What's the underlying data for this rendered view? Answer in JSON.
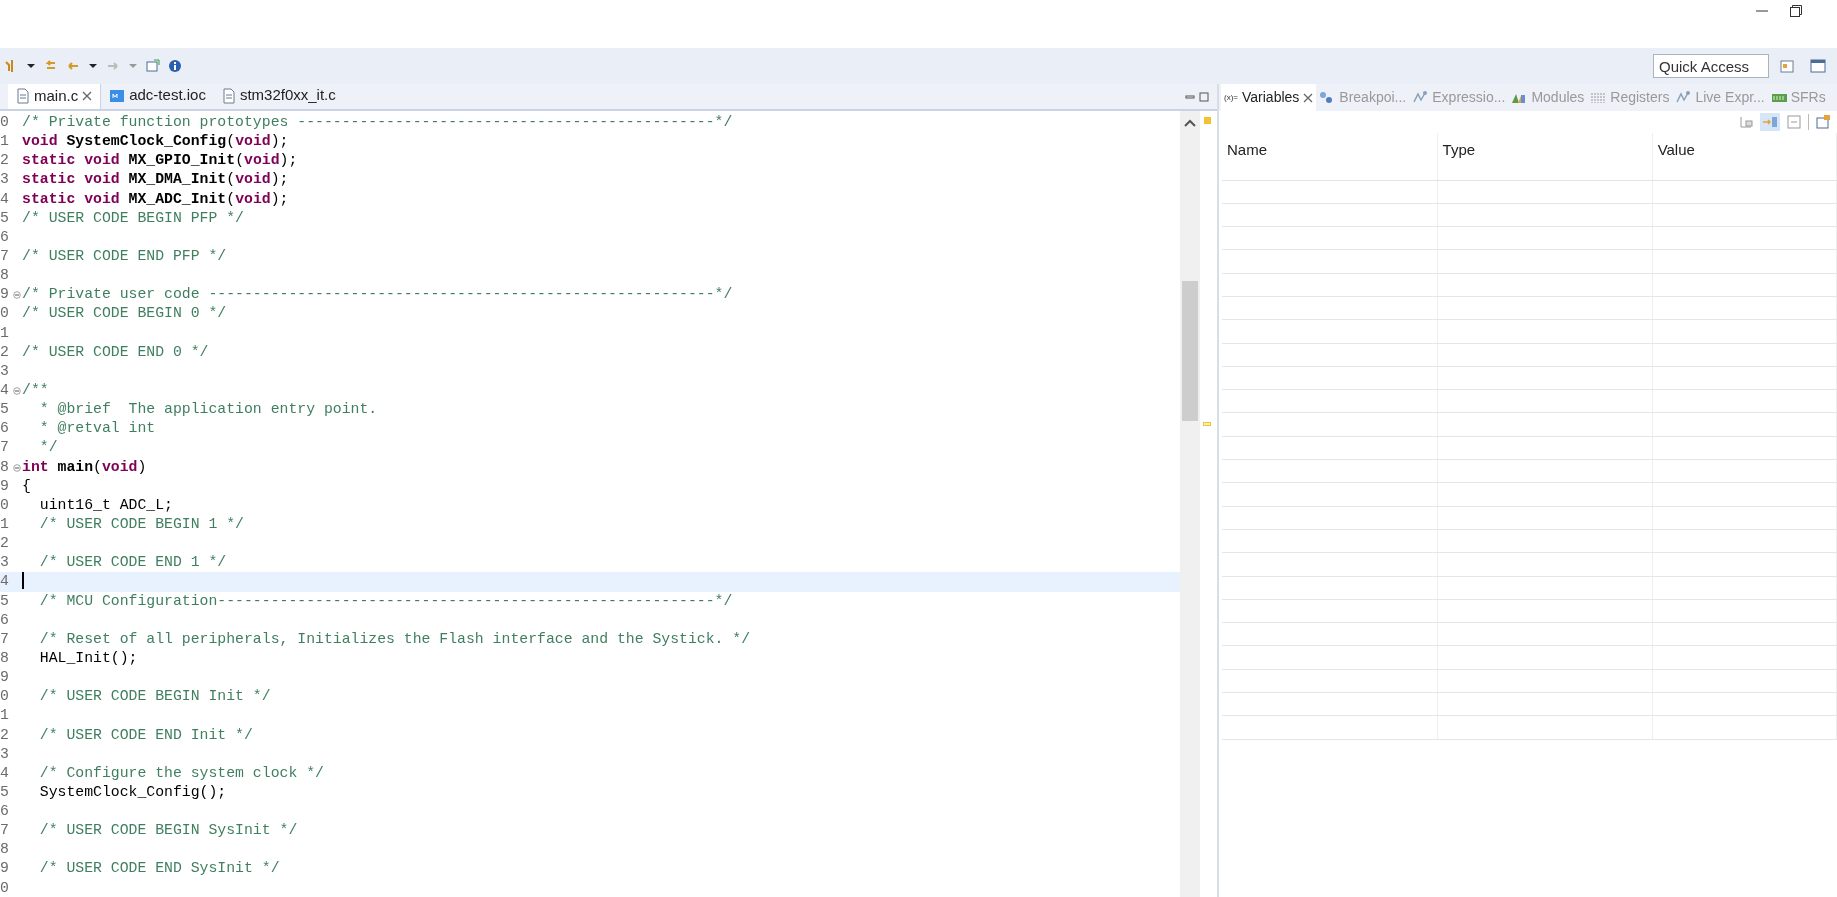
{
  "window_controls": {
    "minimize": true,
    "restore": true
  },
  "toolbar": {
    "quick_access": {
      "placeholder": "Quick Access"
    }
  },
  "editor": {
    "tabs": [
      {
        "label": "main.c",
        "kind": "c-file",
        "selected": true
      },
      {
        "label": "adc-test.ioc",
        "kind": "ioc",
        "selected": false
      },
      {
        "label": "stm32f0xx_it.c",
        "kind": "c-file",
        "selected": false
      }
    ],
    "lines": [
      {
        "number": "0",
        "segments": [
          {
            "kind": "comment",
            "text": "/* Private function prototypes -----------------------------------------------*/"
          }
        ]
      },
      {
        "number": "1",
        "segments": [
          {
            "kind": "keyword",
            "text": "void"
          },
          {
            "kind": "bold",
            "text": " SystemClock_Config"
          },
          {
            "kind": "plain",
            "text": "("
          },
          {
            "kind": "keyword",
            "text": "void"
          },
          {
            "kind": "plain",
            "text": ");"
          }
        ]
      },
      {
        "number": "2",
        "segments": [
          {
            "kind": "keyword",
            "text": "static void"
          },
          {
            "kind": "bold",
            "text": " MX_GPIO_Init"
          },
          {
            "kind": "plain",
            "text": "("
          },
          {
            "kind": "keyword",
            "text": "void"
          },
          {
            "kind": "plain",
            "text": ");"
          }
        ]
      },
      {
        "number": "3",
        "segments": [
          {
            "kind": "keyword",
            "text": "static void"
          },
          {
            "kind": "bold",
            "text": " MX_DMA_Init"
          },
          {
            "kind": "plain",
            "text": "("
          },
          {
            "kind": "keyword",
            "text": "void"
          },
          {
            "kind": "plain",
            "text": ");"
          }
        ]
      },
      {
        "number": "4",
        "segments": [
          {
            "kind": "keyword",
            "text": "static void"
          },
          {
            "kind": "bold",
            "text": " MX_ADC_Init"
          },
          {
            "kind": "plain",
            "text": "("
          },
          {
            "kind": "keyword",
            "text": "void"
          },
          {
            "kind": "plain",
            "text": ");"
          }
        ]
      },
      {
        "number": "5",
        "segments": [
          {
            "kind": "comment",
            "text": "/* USER CODE BEGIN PFP */"
          }
        ]
      },
      {
        "number": "6"
      },
      {
        "number": "7",
        "segments": [
          {
            "kind": "comment",
            "text": "/* USER CODE END PFP */"
          }
        ]
      },
      {
        "number": "8"
      },
      {
        "number": "9",
        "fold": true,
        "segments": [
          {
            "kind": "comment",
            "text": "/* Private user code ---------------------------------------------------------*/"
          }
        ]
      },
      {
        "number": "0",
        "segments": [
          {
            "kind": "comment",
            "text": "/* USER CODE BEGIN 0 */"
          }
        ]
      },
      {
        "number": "1"
      },
      {
        "number": "2",
        "segments": [
          {
            "kind": "comment",
            "text": "/* USER CODE END 0 */"
          }
        ]
      },
      {
        "number": "3"
      },
      {
        "number": "4",
        "fold": true,
        "segments": [
          {
            "kind": "comment",
            "text": "/**"
          }
        ]
      },
      {
        "number": "5",
        "segments": [
          {
            "kind": "comment",
            "text": "  * @brief  The application entry point."
          }
        ]
      },
      {
        "number": "6",
        "segments": [
          {
            "kind": "comment",
            "text": "  * @retval int"
          }
        ]
      },
      {
        "number": "7",
        "segments": [
          {
            "kind": "comment",
            "text": "  */"
          }
        ]
      },
      {
        "number": "8",
        "fold": true,
        "segments": [
          {
            "kind": "keyword",
            "text": "int"
          },
          {
            "kind": "bold",
            "text": " main"
          },
          {
            "kind": "plain",
            "text": "("
          },
          {
            "kind": "keyword",
            "text": "void"
          },
          {
            "kind": "plain",
            "text": ")"
          }
        ]
      },
      {
        "number": "9",
        "segments": [
          {
            "kind": "plain",
            "text": "{"
          }
        ]
      },
      {
        "number": "0",
        "segments": [
          {
            "kind": "plain",
            "text": "  uint16_t ADC_L;"
          }
        ]
      },
      {
        "number": "1",
        "segments": [
          {
            "kind": "comment",
            "text": "  /* USER CODE BEGIN 1 */"
          }
        ]
      },
      {
        "number": "2"
      },
      {
        "number": "3",
        "segments": [
          {
            "kind": "comment",
            "text": "  /* USER CODE END 1 */"
          }
        ]
      },
      {
        "number": "4",
        "current": true
      },
      {
        "number": "5",
        "segments": [
          {
            "kind": "comment",
            "text": "  /* MCU Configuration--------------------------------------------------------*/"
          }
        ]
      },
      {
        "number": "6"
      },
      {
        "number": "7",
        "segments": [
          {
            "kind": "comment",
            "text": "  /* Reset of all peripherals, Initializes the Flash interface and the Systick. */"
          }
        ]
      },
      {
        "number": "8",
        "segments": [
          {
            "kind": "plain",
            "text": "  HAL_Init();"
          }
        ]
      },
      {
        "number": "9"
      },
      {
        "number": "0",
        "segments": [
          {
            "kind": "comment",
            "text": "  /* USER CODE BEGIN Init */"
          }
        ]
      },
      {
        "number": "1"
      },
      {
        "number": "2",
        "segments": [
          {
            "kind": "comment",
            "text": "  /* USER CODE END Init */"
          }
        ]
      },
      {
        "number": "3"
      },
      {
        "number": "4",
        "segments": [
          {
            "kind": "comment",
            "text": "  /* Configure the system clock */"
          }
        ]
      },
      {
        "number": "5",
        "segments": [
          {
            "kind": "plain",
            "text": "  SystemClock_Config();"
          }
        ]
      },
      {
        "number": "6"
      },
      {
        "number": "7",
        "segments": [
          {
            "kind": "comment",
            "text": "  /* USER CODE BEGIN SysInit */"
          }
        ]
      },
      {
        "number": "8"
      },
      {
        "number": "9",
        "segments": [
          {
            "kind": "comment",
            "text": "  /* USER CODE END SysInit */"
          }
        ]
      },
      {
        "number": "0"
      }
    ]
  },
  "debug_panel": {
    "tabs": [
      {
        "label": "Variables",
        "kind": "variables",
        "icon_text": "(x)=",
        "selected": true
      },
      {
        "label": "Breakpoi...",
        "kind": "breakpoints",
        "selected": false
      },
      {
        "label": "Expressio...",
        "kind": "expressions",
        "selected": false
      },
      {
        "label": "Modules",
        "kind": "modules",
        "selected": false
      },
      {
        "label": "Registers",
        "kind": "registers",
        "selected": false
      },
      {
        "label": "Live Expr...",
        "kind": "expressions",
        "selected": false
      },
      {
        "label": "SFRs",
        "kind": "sfrs",
        "selected": false
      }
    ],
    "view_toolbar": [
      {
        "pressed": false
      },
      {
        "pressed": true
      },
      {
        "pressed": false
      }
    ],
    "table": {
      "columns": [
        "Name",
        "Type",
        "Value"
      ]
    }
  }
}
